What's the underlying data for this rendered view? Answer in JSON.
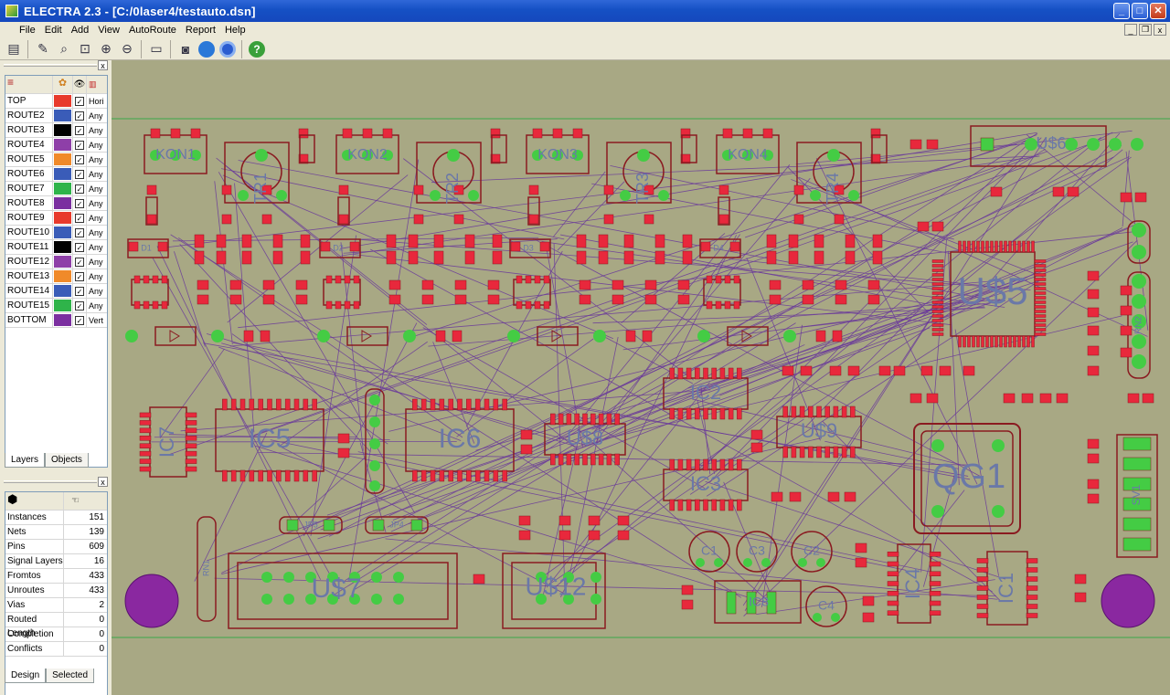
{
  "window": {
    "title": "ELECTRA 2.3 - [C:/0laser4/testauto.dsn]",
    "minimize_glyph": "_",
    "maximize_glyph": "□",
    "close_glyph": "✕"
  },
  "menu": [
    "File",
    "Edit",
    "Add",
    "View",
    "AutoRoute",
    "Report",
    "Help"
  ],
  "toolbar": {
    "icons": [
      "open-icon",
      "brush-icon",
      "zoom-area-icon",
      "zoom-window-icon",
      "zoom-in-icon",
      "zoom-out-icon",
      "ruler-icon",
      "camera-icon",
      "globe-icon",
      "record-icon",
      "help-icon"
    ],
    "help_glyph": "?"
  },
  "layers_panel": {
    "close_glyph": "x",
    "headers": {
      "name": "",
      "color": "",
      "visible": "",
      "dir": ""
    },
    "rows": [
      {
        "name": "TOP",
        "color": "#e83a2c",
        "dir": "Hori"
      },
      {
        "name": "ROUTE2",
        "color": "#3a5cb8",
        "dir": "Any"
      },
      {
        "name": "ROUTE3",
        "color": "#000000",
        "dir": "Any"
      },
      {
        "name": "ROUTE4",
        "color": "#8e3fa8",
        "dir": "Any"
      },
      {
        "name": "ROUTE5",
        "color": "#f08a2a",
        "dir": "Any"
      },
      {
        "name": "ROUTE6",
        "color": "#3a5cb8",
        "dir": "Any"
      },
      {
        "name": "ROUTE7",
        "color": "#2fb44a",
        "dir": "Any"
      },
      {
        "name": "ROUTE8",
        "color": "#7b2fa0",
        "dir": "Any"
      },
      {
        "name": "ROUTE9",
        "color": "#e83a2c",
        "dir": "Any"
      },
      {
        "name": "ROUTE10",
        "color": "#3a5cb8",
        "dir": "Any"
      },
      {
        "name": "ROUTE11",
        "color": "#000000",
        "dir": "Any"
      },
      {
        "name": "ROUTE12",
        "color": "#8e3fa8",
        "dir": "Any"
      },
      {
        "name": "ROUTE13",
        "color": "#f08a2a",
        "dir": "Any"
      },
      {
        "name": "ROUTE14",
        "color": "#3a5cb8",
        "dir": "Any"
      },
      {
        "name": "ROUTE15",
        "color": "#2fb44a",
        "dir": "Any"
      },
      {
        "name": "BOTTOM",
        "color": "#7b2fa0",
        "dir": "Vert"
      }
    ],
    "tabs": [
      "Layers",
      "Objects"
    ]
  },
  "stats_panel": {
    "close_glyph": "x",
    "rows": [
      {
        "label": "Instances",
        "value": "151"
      },
      {
        "label": "Nets",
        "value": "139"
      },
      {
        "label": "Pins",
        "value": "609"
      },
      {
        "label": "Signal Layers",
        "value": "16"
      },
      {
        "label": "Fromtos",
        "value": "433"
      },
      {
        "label": "Unroutes",
        "value": "433"
      },
      {
        "label": "Vias",
        "value": "2"
      },
      {
        "label": "Routed Length",
        "value": "0"
      },
      {
        "label": "Completion",
        "value": "0"
      },
      {
        "label": "Conflicts",
        "value": "0"
      }
    ],
    "tabs": [
      "Design",
      "Selected"
    ]
  },
  "board": {
    "labels": {
      "kon1": "KON1",
      "kon2": "KON2",
      "kon3": "KON3",
      "kon4": "KON4",
      "tr1": "TR1",
      "tr2": "TR2",
      "tr3": "TR3",
      "tr4": "TR4",
      "us6": "U$6",
      "us5": "U$5",
      "ic2": "IC2",
      "ic3": "IC3",
      "ic5": "IC5",
      "ic6": "IC6",
      "ic7": "IC7",
      "us8": "U$8",
      "us9": "U$9",
      "qg1": "QG1",
      "us7": "U$7",
      "us12": "U$12",
      "c1": "C1",
      "c3": "C3",
      "c2": "C2",
      "c4": "C4",
      "ic8": "IC8",
      "ic4": "IC4",
      "ic1": "IC1",
      "d1": "D1",
      "d2": "D2",
      "d3": "D3",
      "d4": "D4",
      "jp5": "JP5",
      "jp4": "JP4",
      "rn2": "RN2",
      "rn1": "RN1",
      "sv1": "SV1"
    },
    "colors": {
      "background": "#a8a884",
      "pad": "#e8283c",
      "outline": "#8a1a20",
      "ratsnest": "#6a3a9a",
      "green_pad": "#44cc44",
      "mount_hole": "#8a28a0",
      "edge_line": "#3aa84a"
    }
  }
}
